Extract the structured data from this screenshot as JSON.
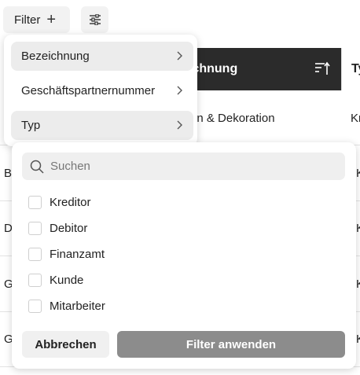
{
  "toolbar": {
    "filter_label": "Filter",
    "filter_add_icon": "plus-icon",
    "settings_icon": "sliders-icon"
  },
  "table": {
    "header_1": "ichnung",
    "header_2": "Ty",
    "sort_icon": "sort-ascending-icon",
    "row1_col1": "en & Dekoration",
    "row1_col2": "Kr",
    "row_fragments": [
      "B",
      "D",
      "G",
      "G"
    ],
    "row_fragments_right": [
      "K",
      "K",
      "K",
      "K"
    ]
  },
  "menu": {
    "items": [
      {
        "label": "Bezeichnung"
      },
      {
        "label": "Geschäftspartnernummer"
      },
      {
        "label": "Typ"
      }
    ],
    "chevron_icon": "chevron-right-icon"
  },
  "panel": {
    "search_placeholder": "Suchen",
    "search_icon": "search-icon",
    "options": [
      {
        "label": "Kreditor",
        "checked": false
      },
      {
        "label": "Debitor",
        "checked": false
      },
      {
        "label": "Finanzamt",
        "checked": false
      },
      {
        "label": "Kunde",
        "checked": false
      },
      {
        "label": "Mitarbeiter",
        "checked": false
      }
    ],
    "cancel_label": "Abbrechen",
    "apply_label": "Filter anwenden"
  },
  "colors": {
    "header_bg": "#2b2b2b",
    "apply_bg": "#8c8c8c",
    "active_item_bg": "#ececec"
  }
}
